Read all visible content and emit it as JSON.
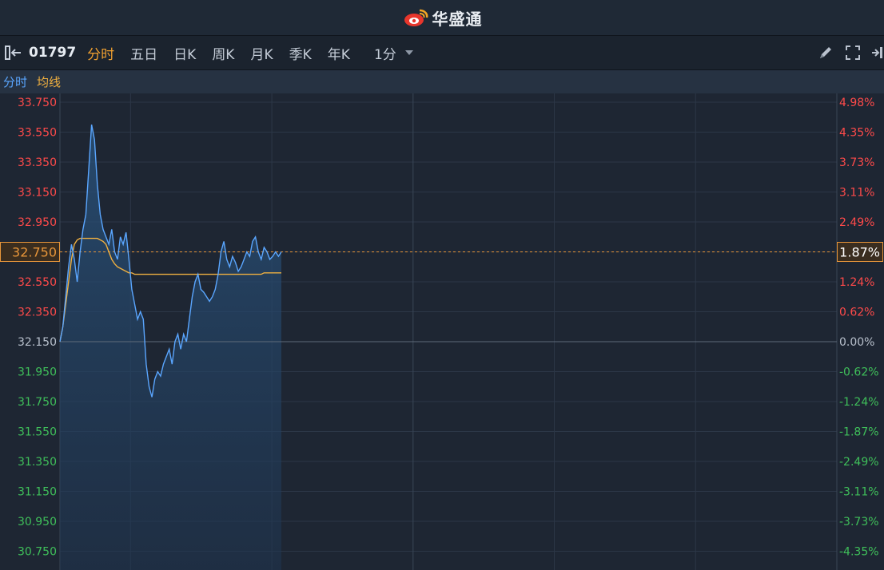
{
  "header": {
    "brand_name": "华盛通",
    "brand_icon": "weibo-style-eye-logo"
  },
  "toolbar": {
    "stock_code": "01797",
    "tabs": [
      "分时",
      "五日",
      "日K",
      "周K",
      "月K",
      "季K",
      "年K"
    ],
    "active_tab": 0,
    "interval": "1分",
    "icons": [
      "panel-toggle-icon",
      "draw-pen-icon",
      "fullscreen-icon",
      "exit-arrow-icon"
    ]
  },
  "legend": {
    "price_label": "分时",
    "avg_label": "均线"
  },
  "colors": {
    "price_line": "#5aa6ff",
    "avg_line": "#f0b040",
    "up": "#ff4a4a",
    "down": "#3fbf5a",
    "neutral": "#b8c0cc",
    "active_tab": "#f0a030",
    "current_marker": "#e8963a"
  },
  "chart_data": {
    "type": "line",
    "y_tick_labels": [
      "33.750",
      "33.550",
      "33.350",
      "33.150",
      "32.950",
      "32.750",
      "32.550",
      "32.350",
      "32.150",
      "31.950",
      "31.750",
      "31.550",
      "31.350",
      "31.150",
      "30.950",
      "30.750"
    ],
    "pct_tick_labels": [
      "4.98%",
      "4.35%",
      "3.73%",
      "3.11%",
      "2.49%",
      "1.87%",
      "1.24%",
      "0.62%",
      "0.00%",
      "-0.62%",
      "-1.24%",
      "-1.87%",
      "-2.49%",
      "-3.11%",
      "-3.73%",
      "-4.35%"
    ],
    "ylim": [
      30.75,
      33.75
    ],
    "prev_close": 32.15,
    "current_price": "32.750",
    "current_pct": "1.87%",
    "series": [
      {
        "kind": "price",
        "values": [
          32.15,
          32.25,
          32.45,
          32.65,
          32.8,
          32.7,
          32.55,
          32.75,
          32.9,
          33.0,
          33.3,
          33.6,
          33.5,
          33.2,
          33.0,
          32.9,
          32.85,
          32.8,
          32.9,
          32.75,
          32.7,
          32.85,
          32.8,
          32.88,
          32.7,
          32.5,
          32.4,
          32.3,
          32.35,
          32.3,
          32.0,
          31.85,
          31.78,
          31.9,
          31.95,
          31.92,
          32.0,
          32.05,
          32.1,
          32.0,
          32.15,
          32.2,
          32.1,
          32.2,
          32.15,
          32.3,
          32.45,
          32.55,
          32.6,
          32.5,
          32.48,
          32.45,
          32.42,
          32.45,
          32.5,
          32.6,
          32.75,
          32.82,
          32.7,
          32.65,
          32.72,
          32.68,
          32.62,
          32.65,
          32.7,
          32.75,
          32.72,
          32.82,
          32.85,
          32.75,
          32.7,
          32.78,
          32.75,
          32.7,
          32.72,
          32.75,
          32.72,
          32.75
        ]
      },
      {
        "kind": "avg",
        "values": [
          32.15,
          32.25,
          32.4,
          32.55,
          32.7,
          32.8,
          32.83,
          32.84,
          32.84,
          32.84,
          32.84,
          32.84,
          32.84,
          32.84,
          32.83,
          32.82,
          32.8,
          32.75,
          32.7,
          32.67,
          32.65,
          32.64,
          32.63,
          32.62,
          32.61,
          32.61,
          32.6,
          32.6,
          32.6,
          32.6,
          32.6,
          32.6,
          32.6,
          32.6,
          32.6,
          32.6,
          32.6,
          32.6,
          32.6,
          32.6,
          32.6,
          32.6,
          32.6,
          32.6,
          32.6,
          32.6,
          32.6,
          32.6,
          32.6,
          32.6,
          32.6,
          32.6,
          32.6,
          32.6,
          32.6,
          32.6,
          32.6,
          32.6,
          32.6,
          32.6,
          32.6,
          32.6,
          32.6,
          32.6,
          32.6,
          32.6,
          32.6,
          32.6,
          32.6,
          32.6,
          32.6,
          32.61,
          32.61,
          32.61,
          32.61,
          32.61,
          32.61,
          32.61
        ]
      }
    ],
    "x_progress": 0.285
  }
}
